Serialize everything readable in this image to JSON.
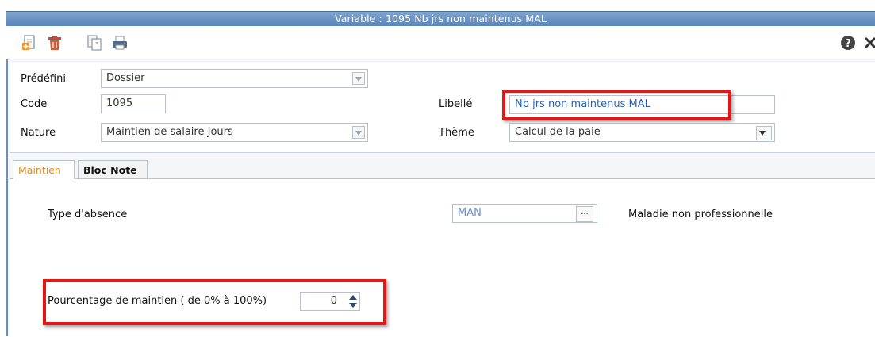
{
  "window": {
    "title": "Variable : 1095 Nb jrs non maintenus MAL"
  },
  "toolbar": {
    "buttons": [
      {
        "icon": "new-document-icon"
      },
      {
        "icon": "trash-icon"
      },
      {
        "icon": "copy-icon"
      },
      {
        "icon": "print-icon"
      }
    ],
    "help_icon": "help-icon"
  },
  "header": {
    "predefini": {
      "label": "Prédéfini",
      "value": "Dossier"
    },
    "code": {
      "label": "Code",
      "value": "1095"
    },
    "nature": {
      "label": "Nature",
      "value": "Maintien de salaire Jours"
    },
    "libelle": {
      "label": "Libellé",
      "value": "Nb jrs non maintenus MAL"
    },
    "theme": {
      "label": "Thème",
      "value": "Calcul de la paie"
    }
  },
  "tabs": [
    {
      "label": "Maintien",
      "active": true
    },
    {
      "label": "Bloc Note",
      "active": false
    }
  ],
  "maintien": {
    "absence_type": {
      "label": "Type d'absence",
      "code": "MAN",
      "ellipsis": "...",
      "description": "Maladie non professionnelle"
    },
    "percentage": {
      "label": "Pourcentage de maintien ( de 0% à 100%)",
      "value": "0"
    }
  },
  "colors": {
    "accent_orange": "#e08a1e",
    "title_blue": "#5b84b8",
    "highlight_red": "#e41616"
  }
}
